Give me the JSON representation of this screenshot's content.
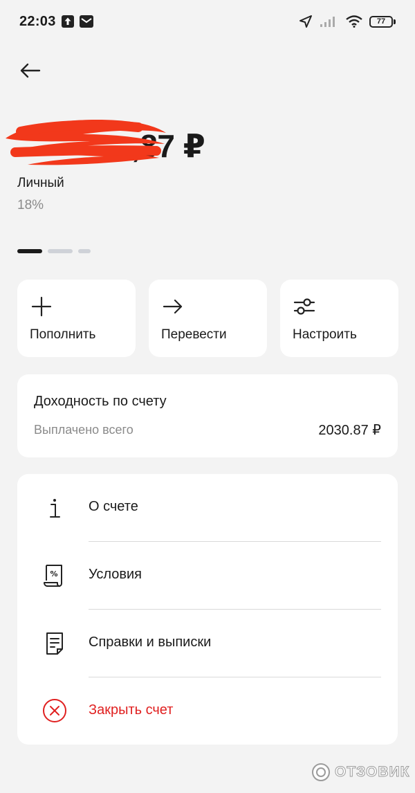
{
  "status_bar": {
    "time": "22:03",
    "battery": "77",
    "icons": [
      "upload-notification-icon",
      "mail-notification-icon",
      "location-arrow-icon",
      "signal-icon",
      "wifi-icon",
      "battery-icon"
    ]
  },
  "header": {
    "back_icon": "arrow-left-icon"
  },
  "account": {
    "balance_visible": ",87 ₽",
    "balance_redacted": true,
    "name": "Личный",
    "rate": "18%",
    "pager_count": 3,
    "pager_active": 0
  },
  "actions": [
    {
      "label": "Пополнить",
      "icon": "plus-icon"
    },
    {
      "label": "Перевести",
      "icon": "arrow-right-icon"
    },
    {
      "label": "Настроить",
      "icon": "sliders-icon"
    }
  ],
  "yield": {
    "title": "Доходность по счету",
    "paid_label": "Выплачено всего",
    "paid_value": "2030.87 ₽"
  },
  "menu": [
    {
      "label": "О счете",
      "icon": "info-icon"
    },
    {
      "label": "Условия",
      "icon": "percent-document-icon"
    },
    {
      "label": "Справки и выписки",
      "icon": "document-icon"
    },
    {
      "label": "Закрыть счет",
      "icon": "close-circle-icon"
    }
  ],
  "colors": {
    "background": "#f3f3f3",
    "card": "#ffffff",
    "danger": "#e02020",
    "redaction": "#f2381b",
    "muted_text": "#8a8a8a"
  },
  "watermark": "ОТЗОВИК"
}
